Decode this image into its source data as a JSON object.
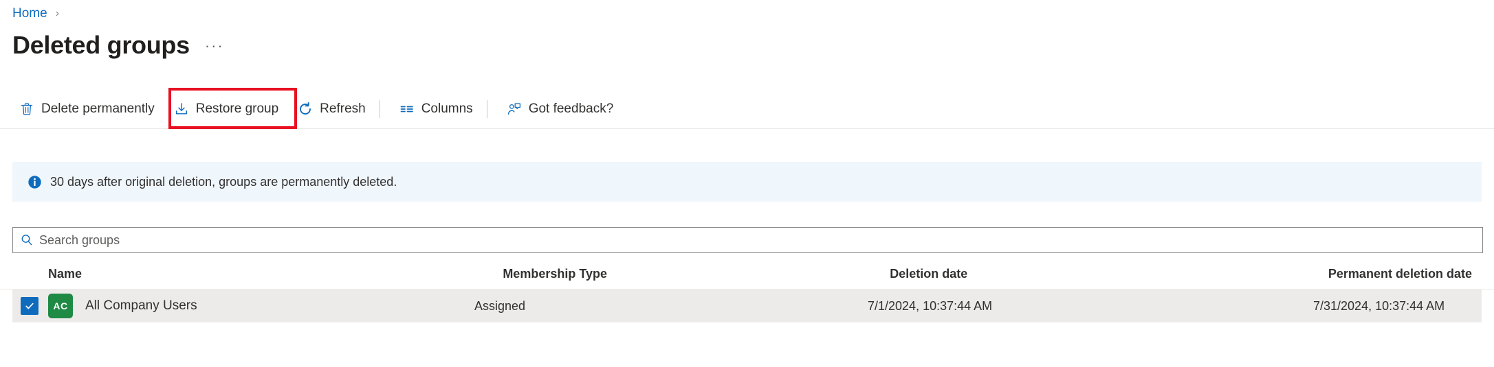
{
  "breadcrumb": {
    "home_label": "Home",
    "separator": "›"
  },
  "page": {
    "title": "Deleted groups",
    "more_actions": "···"
  },
  "toolbar": {
    "delete_permanently": "Delete permanently",
    "restore_group": "Restore group",
    "refresh": "Refresh",
    "columns": "Columns",
    "got_feedback": "Got feedback?",
    "highlight_color": "#e81123",
    "icon_color": "#0f6cbd"
  },
  "info_banner": {
    "message": "30 days after original deletion, groups are permanently deleted.",
    "background": "#eff6fc",
    "icon_color": "#0f6cbd"
  },
  "search": {
    "placeholder": "Search groups",
    "value": ""
  },
  "table": {
    "columns": [
      "Name",
      "Membership Type",
      "Deletion date",
      "Permanent deletion date"
    ],
    "rows": [
      {
        "selected": true,
        "avatar_initials": "AC",
        "avatar_color": "#1e8a44",
        "name": "All Company Users",
        "membership_type": "Assigned",
        "deletion_date": "7/1/2024, 10:37:44 AM",
        "permanent_deletion_date": "7/31/2024, 10:37:44 AM"
      }
    ],
    "row_background": "#edebe9"
  }
}
